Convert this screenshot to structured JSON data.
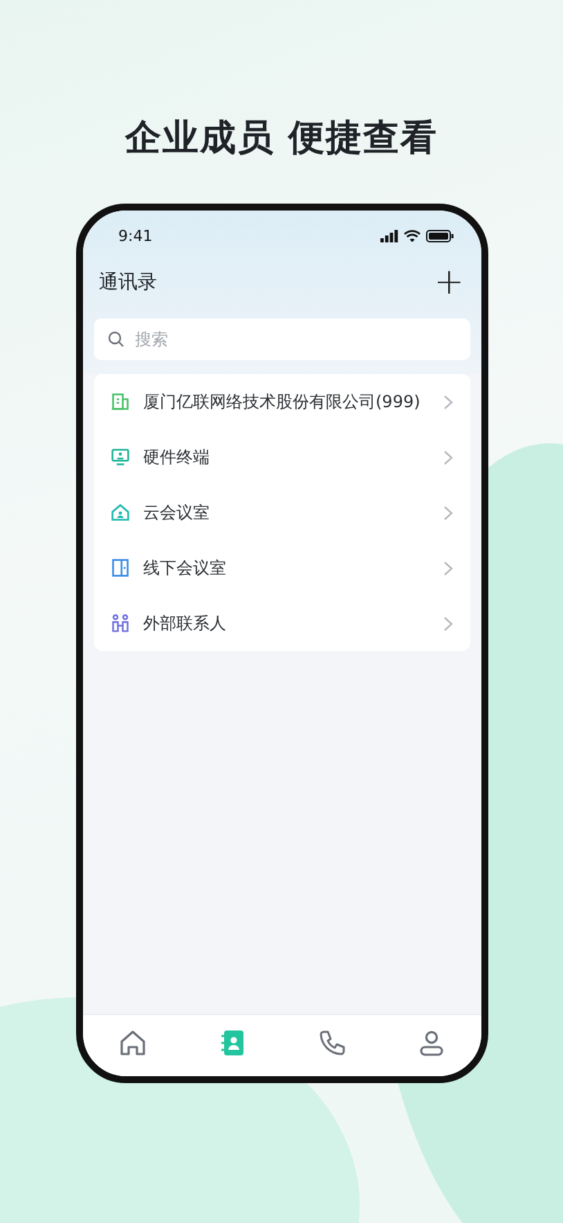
{
  "headline": "企业成员 便捷查看",
  "status_bar": {
    "time": "9:41"
  },
  "header": {
    "title": "通讯录",
    "add": "+"
  },
  "search": {
    "placeholder": "搜索"
  },
  "items": [
    {
      "kind": "building",
      "label": "厦门亿联网络技术股份有限公司(999)"
    },
    {
      "kind": "terminal",
      "label": "硬件终端"
    },
    {
      "kind": "cloud-room",
      "label": "云会议室"
    },
    {
      "kind": "door",
      "label": "线下会议室"
    },
    {
      "kind": "people",
      "label": "外部联系人"
    }
  ],
  "tabs": [
    {
      "kind": "home",
      "selected": false
    },
    {
      "kind": "contacts",
      "selected": true
    },
    {
      "kind": "phone",
      "selected": false
    },
    {
      "kind": "profile",
      "selected": false
    }
  ]
}
